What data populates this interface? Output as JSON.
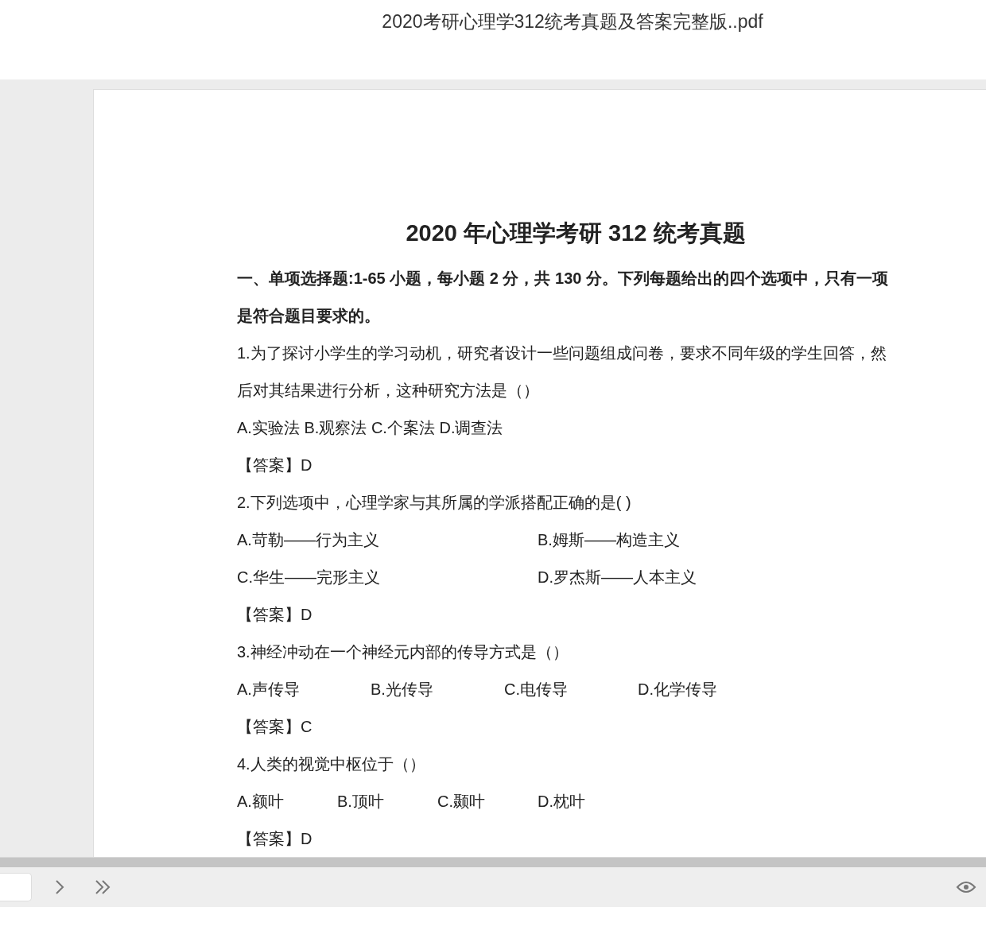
{
  "window": {
    "title": "2020考研心理学312统考真题及答案完整版..pdf"
  },
  "page": {
    "heading": "2020 年心理学考研 312 统考真题",
    "intro": "一、单项选择题:1-65 小题，每小题 2 分，共 130 分。下列每题给出的四个选项中，只有一项是符合题目要求的。",
    "questions": [
      {
        "stem": "1.为了探讨小学生的学习动机，研究者设计一些问题组成问卷，要求不同年级的学生回答，然后对其结果进行分析，这种研究方法是（）",
        "kind": "inline",
        "options": [
          "A.实验法 B.观察法 C.个案法 D.调查法"
        ],
        "answer": "【答案】D"
      },
      {
        "stem": "2.下列选项中，心理学家与其所属的学派搭配正确的是( )",
        "kind": "pairs",
        "options": [
          "A.苛勒——行为主义",
          "B.姆斯——构造主义",
          "C.华生——完形主义",
          "D.罗杰斯——人本主义"
        ],
        "answer": "【答案】D"
      },
      {
        "stem": "3.神经冲动在一个神经元内部的传导方式是（）",
        "kind": "wide",
        "options": [
          "A.声传导",
          "B.光传导",
          "C.电传导",
          "D.化学传导"
        ],
        "answer": "【答案】C"
      },
      {
        "stem": "4.人类的视觉中枢位于（）",
        "kind": "narrow",
        "options": [
          "A.额叶",
          "B.顶叶",
          "C.颞叶",
          "D.枕叶"
        ],
        "answer": "【答案】D"
      }
    ]
  }
}
